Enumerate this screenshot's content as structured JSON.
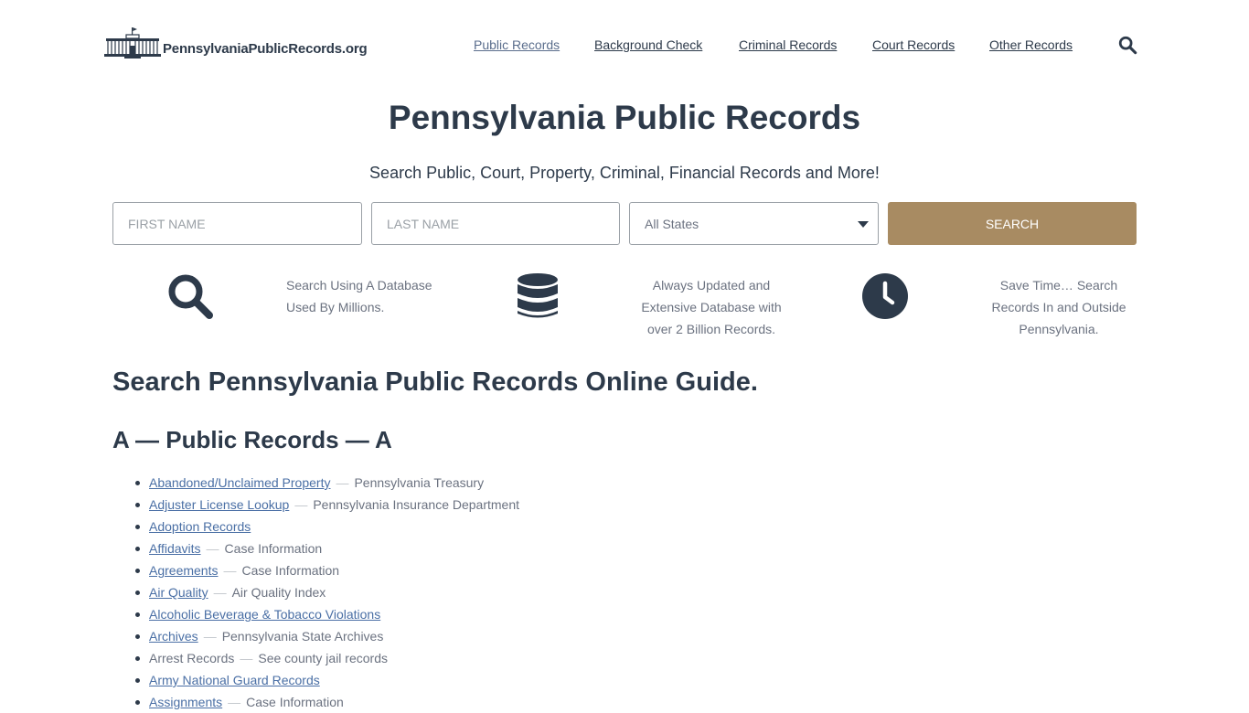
{
  "header": {
    "logo_text": "PennsylvaniaPublicRecords.org",
    "nav": [
      {
        "label": "Public Records",
        "active": true
      },
      {
        "label": "Background Check",
        "active": false
      },
      {
        "label": "Criminal Records",
        "active": false
      },
      {
        "label": "Court Records",
        "active": false
      },
      {
        "label": "Other Records",
        "active": false
      }
    ],
    "search_icon": "search-icon"
  },
  "hero": {
    "title": "Pennsylvania Public Records",
    "subtitle": "Search Public, Court, Property, Criminal, Financial Records and More!"
  },
  "search_form": {
    "first_name_placeholder": "FIRST NAME",
    "last_name_placeholder": "LAST NAME",
    "state_selected": "All States",
    "button_label": "SEARCH",
    "button_color": "#a88b62"
  },
  "features": [
    {
      "icon": "magnifier-icon",
      "line1": "Search Using A Database",
      "line2": "Used By Millions.",
      "line3": ""
    },
    {
      "icon": "database-icon",
      "line1": "Always Updated and",
      "line2": "Extensive Database with",
      "line3": "over 2 Billion Records."
    },
    {
      "icon": "clock-icon",
      "line1": "Save Time… Search",
      "line2": "Records In and Outside",
      "line3": "Pennsylvania."
    }
  ],
  "guide": {
    "title": "Search Pennsylvania Public Records Online Guide.",
    "section": "A — Public Records — A",
    "items": [
      {
        "label": "Abandoned/Unclaimed Property",
        "desc": "Pennsylvania Treasury"
      },
      {
        "label": "Adjuster License Lookup",
        "desc": "Pennsylvania Insurance Department"
      },
      {
        "label": "Adoption Records",
        "desc": ""
      },
      {
        "label": "Affidavits",
        "desc": "Case Information"
      },
      {
        "label": "Agreements",
        "desc": "Case Information"
      },
      {
        "label": "Air Quality",
        "desc": "Air Quality Index"
      },
      {
        "label": "Alcoholic Beverage & Tobacco Violations",
        "desc": ""
      },
      {
        "label": "Archives",
        "desc": "Pennsylvania State Archives"
      },
      {
        "label": "Arrest Records",
        "desc": "See county jail records"
      },
      {
        "label": "Army National Guard Records",
        "desc": ""
      },
      {
        "label": "Assignments",
        "desc": "Case Information"
      }
    ]
  },
  "colors": {
    "text": "#2d3a4a",
    "link": "#4a6fa5",
    "muted": "#6b7280",
    "accent": "#a88b62"
  }
}
